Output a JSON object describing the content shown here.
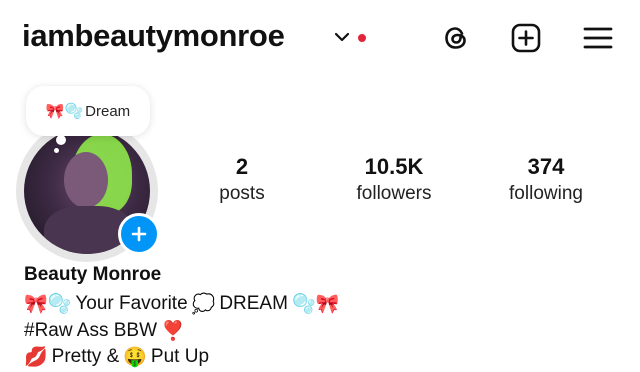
{
  "header": {
    "username": "iambeautymonroe",
    "has_notification_dot": true,
    "icons": [
      "chevron-down-icon",
      "threads-icon",
      "create-icon",
      "menu-icon"
    ]
  },
  "note": {
    "emojis": "🎀🫧",
    "text": "Dream"
  },
  "stats": {
    "posts": {
      "value": "2",
      "label": "posts"
    },
    "followers": {
      "value": "10.5K",
      "label": "followers"
    },
    "following": {
      "value": "374",
      "label": "following"
    }
  },
  "profile": {
    "display_name": "Beauty Monroe",
    "bio": {
      "line1_prefix": "🎀🫧",
      "line1_text": "Your Favorite",
      "line1_mid": "💭",
      "line1_word": "DREAM",
      "line1_suffix": "🫧🎀",
      "line2_text": "#Raw Ass BBW",
      "line2_emoji": "❣️",
      "line3_emoji1": "💋",
      "line3_text1": "Pretty &",
      "line3_emoji2": "🤑",
      "line3_text2": "Put Up"
    }
  },
  "colors": {
    "accent_blue": "#0095f6",
    "notification_red": "#e0243a",
    "text": "#111111"
  }
}
